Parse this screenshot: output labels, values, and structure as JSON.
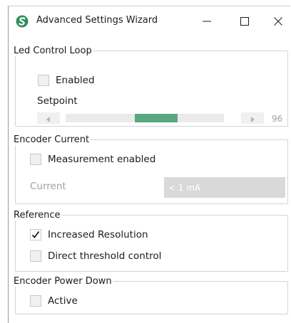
{
  "window": {
    "title": "Advanced Settings Wizard",
    "accent_color": "#5aa67e"
  },
  "led_control_loop": {
    "legend": "Led Control Loop",
    "enabled_label": "Enabled",
    "enabled_checked": false,
    "setpoint_label": "Setpoint",
    "setpoint_value": "96",
    "setpoint_position_fraction": 0.6
  },
  "encoder_current": {
    "legend": "Encoder Current",
    "measurement_label": "Measurement enabled",
    "measurement_checked": false,
    "current_label": "Current",
    "current_value": "< 1 mA"
  },
  "reference": {
    "legend": "Reference",
    "increased_resolution_label": "Increased Resolution",
    "increased_resolution_checked": true,
    "direct_threshold_label": "Direct threshold control",
    "direct_threshold_checked": false
  },
  "encoder_power_down": {
    "legend": "Encoder Power Down",
    "active_label": "Active",
    "active_checked": false
  }
}
